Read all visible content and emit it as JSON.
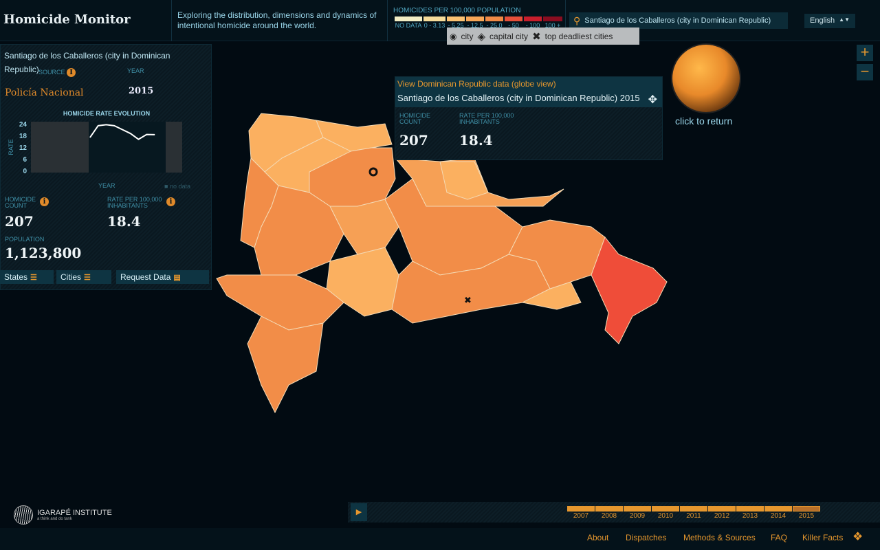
{
  "header": {
    "title": "Homicide Monitor",
    "tagline": "Exploring the distribution, dimensions and dynamics of intentional homicide around the world.",
    "legend_title": "HOMICIDES PER 100,000 POPULATION",
    "legend": [
      {
        "label": "NO DATA",
        "color": "#f3edc4"
      },
      {
        "label": "0 - 3.13",
        "color": "#f7dc9a"
      },
      {
        "label": "- 5.25",
        "color": "#fbc272"
      },
      {
        "label": "- 12.5",
        "color": "#f8a757"
      },
      {
        "label": "- 25.0",
        "color": "#f08a46"
      },
      {
        "label": "- 50",
        "color": "#e6503a"
      },
      {
        "label": "- 100",
        "color": "#c81e2c"
      },
      {
        "label": "100 +",
        "color": "#8a0d20"
      }
    ],
    "type_key": {
      "city": "city",
      "capital": "capital city",
      "deadliest": "top deadliest cities"
    },
    "search_value": "Santiago de los Caballeros (city in Dominican Republic)",
    "language": "English"
  },
  "panel": {
    "title": "Santiago de los Caballeros (city in Dominican Republic)",
    "source_label": "SOURCE",
    "source": "Policía Nacional",
    "year_label": "YEAR",
    "year": "2015",
    "chart_title": "HOMICIDE RATE EVOLUTION",
    "y_label": "RATE",
    "x_label": "YEAR",
    "no_data": "no data",
    "homicide_count_label": "HOMICIDE COUNT",
    "homicide_count": "207",
    "rate_label": "RATE PER 100,000 INHABITANTS",
    "rate": "18.4",
    "population_label": "POPULATION",
    "population": "1,123,800",
    "buttons": {
      "states": "States",
      "cities": "Cities",
      "request": "Request Data"
    }
  },
  "chart_data": {
    "type": "line",
    "title": "HOMICIDE RATE EVOLUTION",
    "xlabel": "YEAR",
    "ylabel": "RATE",
    "ylim": [
      0,
      24
    ],
    "yticks": [
      "24",
      "18",
      "12",
      "6",
      "0"
    ],
    "x": [
      2007,
      2008,
      2009,
      2010,
      2011,
      2012,
      2013,
      2014,
      2015
    ],
    "values": [
      17,
      23,
      23.5,
      23,
      21,
      19,
      16,
      18.5,
      18.4
    ]
  },
  "popup": {
    "link": "View Dominican Republic data (globe view)",
    "title": "Santiago de los Caballeros (city in Dominican Republic) 2015",
    "count_label": "HOMICIDE COUNT",
    "count": "207",
    "rate_label": "RATE PER 100,000 INHABITANTS",
    "rate": "18.4"
  },
  "globe": {
    "caption": "click to return"
  },
  "timeline": {
    "years": [
      "2007",
      "2008",
      "2009",
      "2010",
      "2011",
      "2012",
      "2013",
      "2014",
      "2015"
    ],
    "selected": "2015"
  },
  "footer": {
    "links": [
      "About",
      "Dispatches",
      "Methods & Sources",
      "FAQ",
      "Killer Facts"
    ],
    "org": "IGARAPÉ INSTITUTE",
    "org_sub": "a think and do tank"
  }
}
